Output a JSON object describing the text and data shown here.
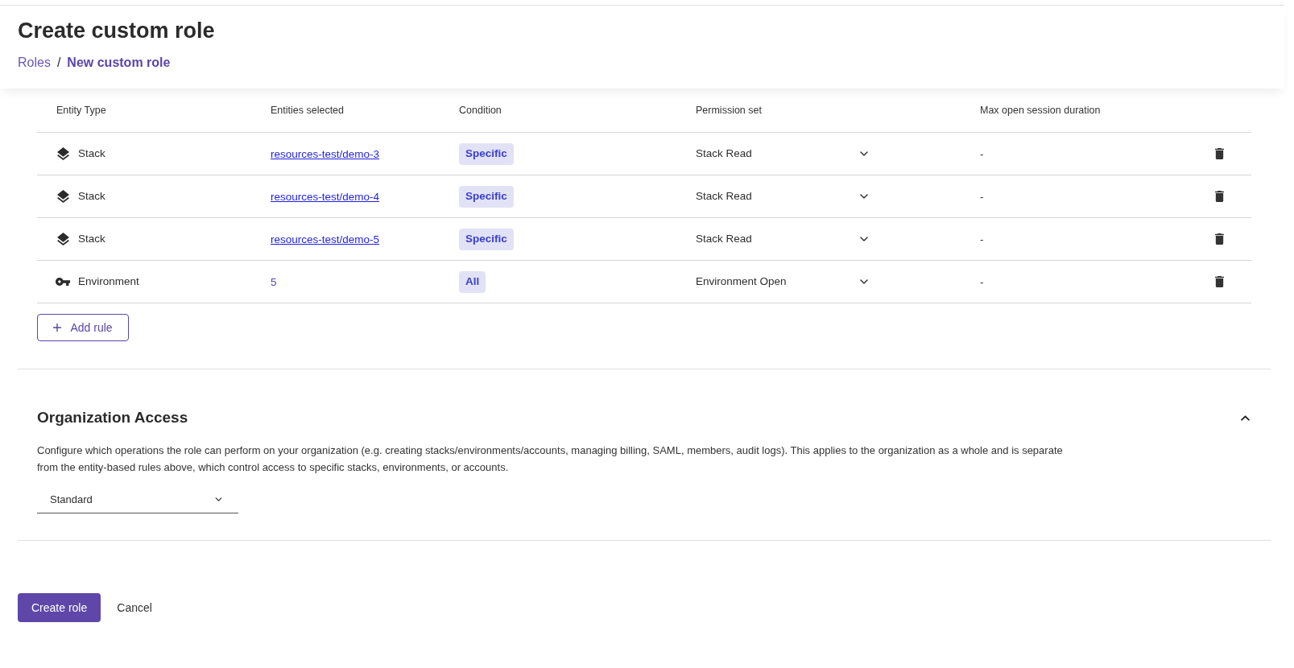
{
  "header": {
    "title": "Create custom role",
    "breadcrumb": [
      {
        "label": "Roles",
        "current": false
      },
      {
        "label": "New custom role",
        "current": true
      }
    ],
    "separator": "/"
  },
  "rules_table": {
    "columns": [
      "Entity Type",
      "Entities selected",
      "Condition",
      "Permission set",
      "Max open session duration"
    ],
    "rows": [
      {
        "entity_type": {
          "kind": "stack",
          "label": "Stack"
        },
        "entities": {
          "kind": "link",
          "text": "resources-test/demo-3"
        },
        "condition": "Specific",
        "permission_set": "Stack Read",
        "max_session_duration": "-"
      },
      {
        "entity_type": {
          "kind": "stack",
          "label": "Stack"
        },
        "entities": {
          "kind": "link",
          "text": "resources-test/demo-4"
        },
        "condition": "Specific",
        "permission_set": "Stack Read",
        "max_session_duration": "-"
      },
      {
        "entity_type": {
          "kind": "stack",
          "label": "Stack"
        },
        "entities": {
          "kind": "link",
          "text": "resources-test/demo-5"
        },
        "condition": "Specific",
        "permission_set": "Stack Read",
        "max_session_duration": "-"
      },
      {
        "entity_type": {
          "kind": "environment",
          "label": "Environment"
        },
        "entities": {
          "kind": "count",
          "text": "5"
        },
        "condition": "All",
        "permission_set": "Environment Open",
        "max_session_duration": "-"
      }
    ],
    "add_button": "Add rule"
  },
  "organization_access": {
    "title": "Organization Access",
    "expanded": true,
    "description": "Configure which operations the role can perform on your organization (e.g. creating stacks/environments/accounts, managing billing, SAML, members, audit logs). This applies to the organization as a whole and is separate from the entity-based rules above, which control access to specific stacks, environments, or accounts.",
    "level_select": "Standard"
  },
  "actions": {
    "primary": "Create role",
    "secondary": "Cancel"
  }
}
